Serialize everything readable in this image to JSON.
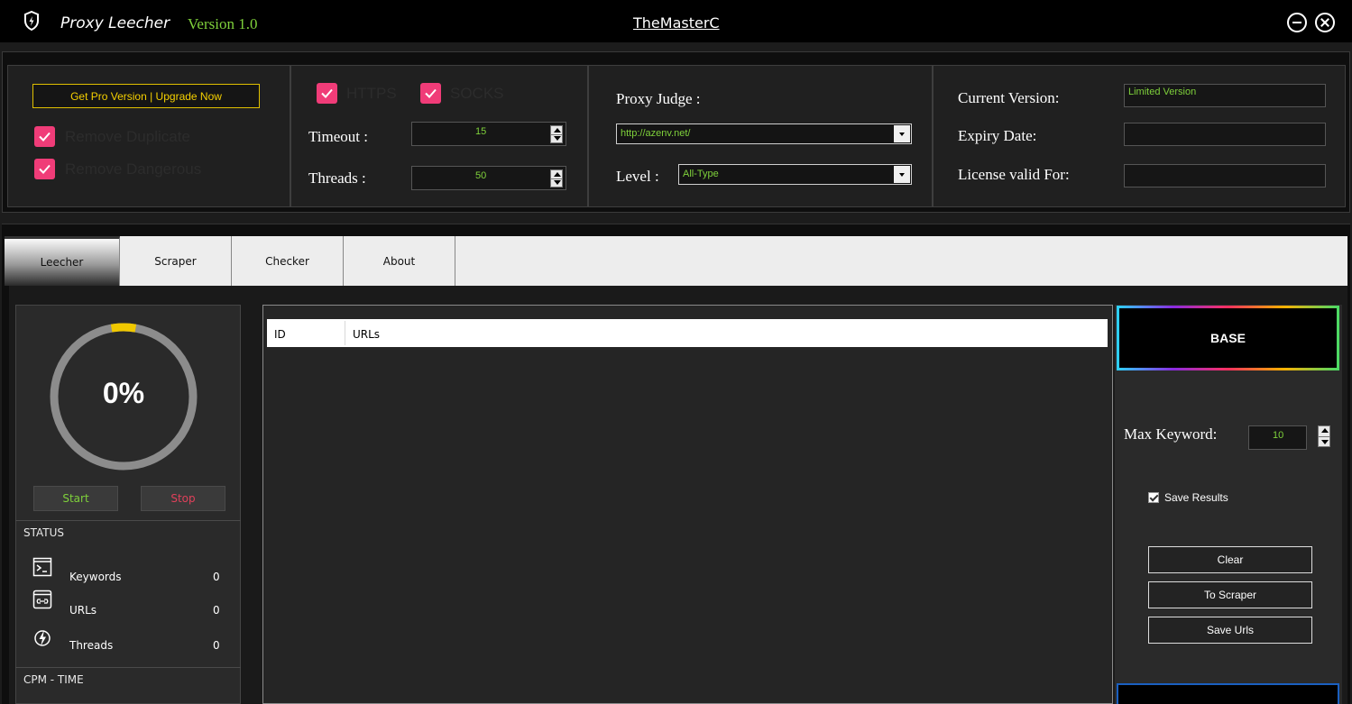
{
  "titlebar": {
    "title": "Proxy Leecher",
    "version": "Version 1.0",
    "author": "TheMasterC",
    "app_icon": "shield-icon",
    "minimize_icon": "minimize-icon",
    "close_icon": "close-icon"
  },
  "settings": {
    "pro_button": "Get Pro Version | Upgrade Now",
    "remove_duplicate": {
      "label": "Remove Duplicate",
      "checked": true
    },
    "remove_dangerous": {
      "label": "Remove Dangerous",
      "checked": true
    },
    "https": {
      "label": "HTTPS",
      "checked": true
    },
    "socks": {
      "label": "SOCKS",
      "checked": true
    },
    "timeout": {
      "label": "Timeout :",
      "value": "15"
    },
    "threads": {
      "label": "Threads :",
      "value": "50"
    },
    "proxy_judge": {
      "label": "Proxy Judge :",
      "value": "http://azenv.net/"
    },
    "level": {
      "label": "Level :",
      "value": "All-Type"
    },
    "current_version": {
      "label": "Current Version:",
      "value": "Limited Version"
    },
    "expiry_date": {
      "label": "Expiry Date:",
      "value": ""
    },
    "license_valid": {
      "label": "License valid For:",
      "value": ""
    }
  },
  "tabs": [
    {
      "label": "Leecher",
      "active": true
    },
    {
      "label": "Scraper",
      "active": false
    },
    {
      "label": "Checker",
      "active": false
    },
    {
      "label": "About",
      "active": false
    }
  ],
  "leecher": {
    "progress_percent": 0,
    "progress_label": "0%",
    "start_label": "Start",
    "stop_label": "Stop",
    "status_header": "STATUS",
    "stats": [
      {
        "label": "Keywords",
        "value": "0",
        "icon": "terminal-icon"
      },
      {
        "label": "URLs",
        "value": "0",
        "icon": "link-window-icon"
      },
      {
        "label": "Threads",
        "value": "0",
        "icon": "lightning-icon"
      }
    ],
    "cpm_header": "CPM - TIME",
    "table": {
      "columns": [
        "ID",
        "URLs"
      ],
      "rows": []
    },
    "base_label": "BASE",
    "max_keyword": {
      "label": "Max Keyword:",
      "value": "10"
    },
    "save_results": {
      "label": "Save Results",
      "checked": true
    },
    "buttons": {
      "clear": "Clear",
      "to_scraper": "To Scraper",
      "save_urls": "Save Urls"
    }
  },
  "colors": {
    "accent_green": "#7fd13b",
    "check_pink": "#f03c78",
    "pro_yellow": "#f5d000",
    "stop_red": "#e0405a",
    "progress_yellow": "#f0c800"
  }
}
